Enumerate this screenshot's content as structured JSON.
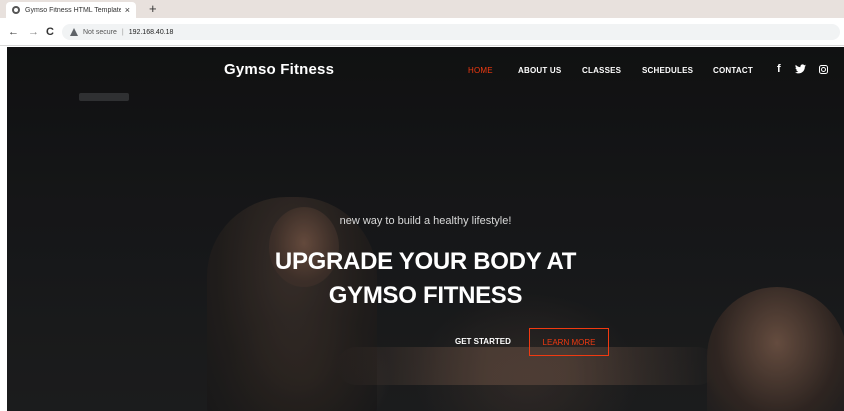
{
  "browser": {
    "tab_title": "Gymso Fitness HTML Template",
    "tab_close": "×",
    "new_tab": "+",
    "back": "←",
    "forward": "→",
    "reload": "C",
    "security_label": "Not secure",
    "separator": "|",
    "url": "192.168.40.18"
  },
  "site": {
    "brand": "Gymso Fitness",
    "nav": {
      "home": "HOME",
      "about": "ABOUT US",
      "classes": "CLASSES",
      "schedules": "SCHEDULES",
      "contact": "CONTACT"
    },
    "social": {
      "facebook": "f",
      "twitter": "🐦"
    },
    "hero": {
      "tagline": "new way to build a healthy lifestyle!",
      "headline_line1": "UPGRADE YOUR BODY AT",
      "headline_line2": "GYMSO FITNESS",
      "get_started": "GET STARTED",
      "learn_more": "LEARN MORE"
    },
    "accent_color": "#f13a11"
  }
}
